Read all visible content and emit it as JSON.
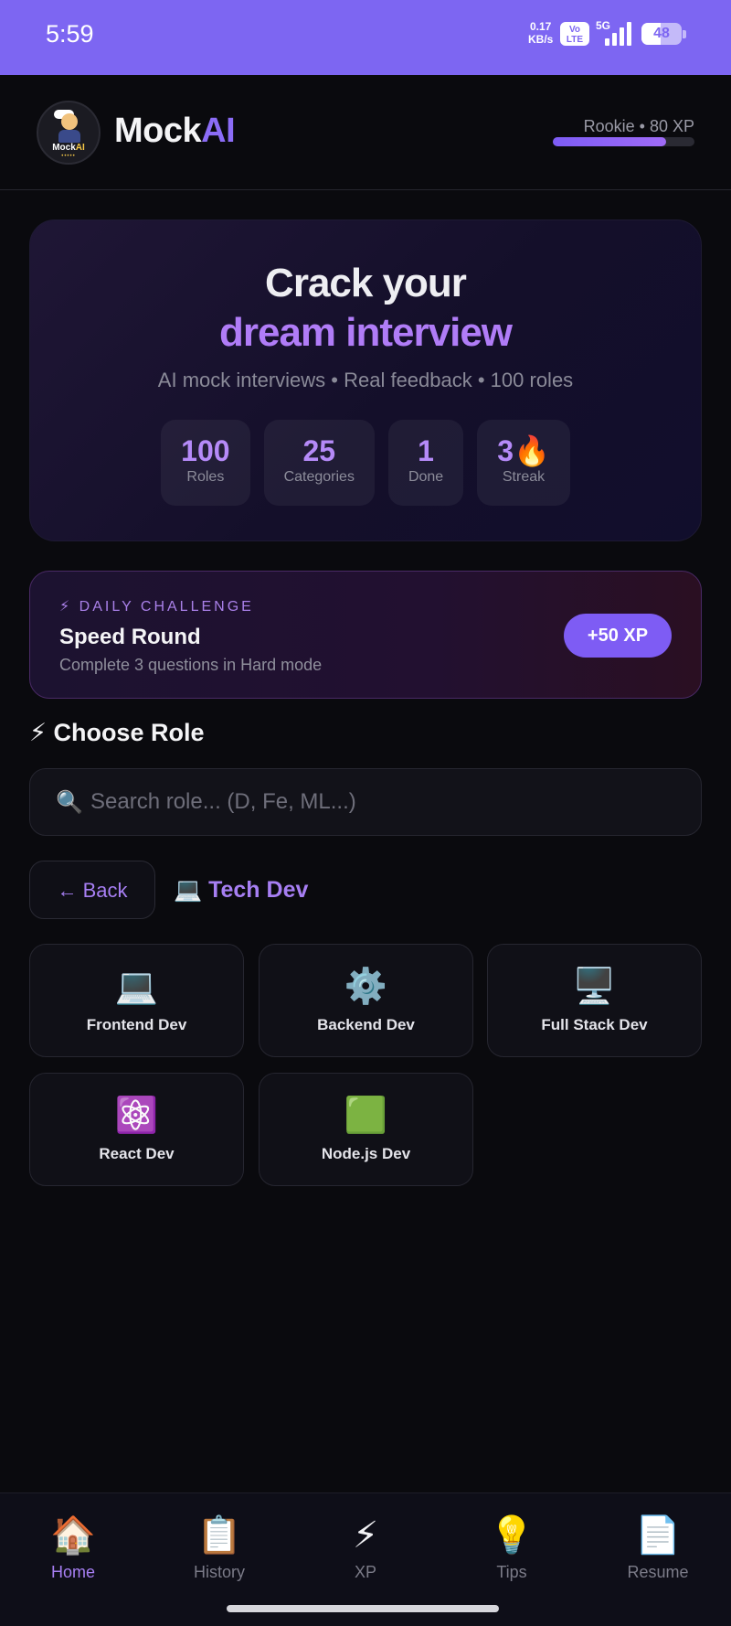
{
  "status_bar": {
    "time": "5:59",
    "net_speed_value": "0.17",
    "net_speed_unit": "KB/s",
    "volte": "Vo LTE",
    "network": "5G",
    "battery": "48",
    "battery_level": 0.48
  },
  "header": {
    "logo_text_a": "Mock",
    "logo_text_b": "AI",
    "brand_a": "Mock",
    "brand_b": "AI",
    "rank": "Rookie • 80 XP",
    "xp_progress": 0.8
  },
  "hero": {
    "line1": "Crack your",
    "line2": "dream interview",
    "subtitle": "AI mock interviews • Real feedback • 100 roles",
    "stats": [
      {
        "value": "100",
        "label": "Roles"
      },
      {
        "value": "25",
        "label": "Categories"
      },
      {
        "value": "1",
        "label": "Done"
      },
      {
        "value": "3🔥",
        "label": "Streak"
      }
    ]
  },
  "daily": {
    "tag": "⚡ DAILY CHALLENGE",
    "title": "Speed Round",
    "description": "Complete 3 questions in Hard mode",
    "reward": "+50 XP"
  },
  "choose": {
    "title": "⚡ Choose Role",
    "search_icon": "🔍",
    "search_placeholder": "Search role... (D, Fe, ML...)",
    "back_label": "← Back",
    "breadcrumb": "💻 Tech Dev"
  },
  "roles": [
    {
      "icon": "💻",
      "label": "Frontend Dev"
    },
    {
      "icon": "⚙️",
      "label": "Backend Dev"
    },
    {
      "icon": "🖥️",
      "label": "Full Stack Dev"
    },
    {
      "icon": "⚛️",
      "label": "React Dev"
    },
    {
      "icon": "🟩",
      "label": "Node.js Dev"
    }
  ],
  "nav": [
    {
      "icon": "🏠",
      "label": "Home"
    },
    {
      "icon": "📋",
      "label": "History"
    },
    {
      "icon": "⚡",
      "label": "XP"
    },
    {
      "icon": "💡",
      "label": "Tips"
    },
    {
      "icon": "📄",
      "label": "Resume"
    }
  ],
  "colors": {
    "accent": "#8b6cf6",
    "status_bar": "#7d66f2",
    "background": "#0a0a0e"
  }
}
